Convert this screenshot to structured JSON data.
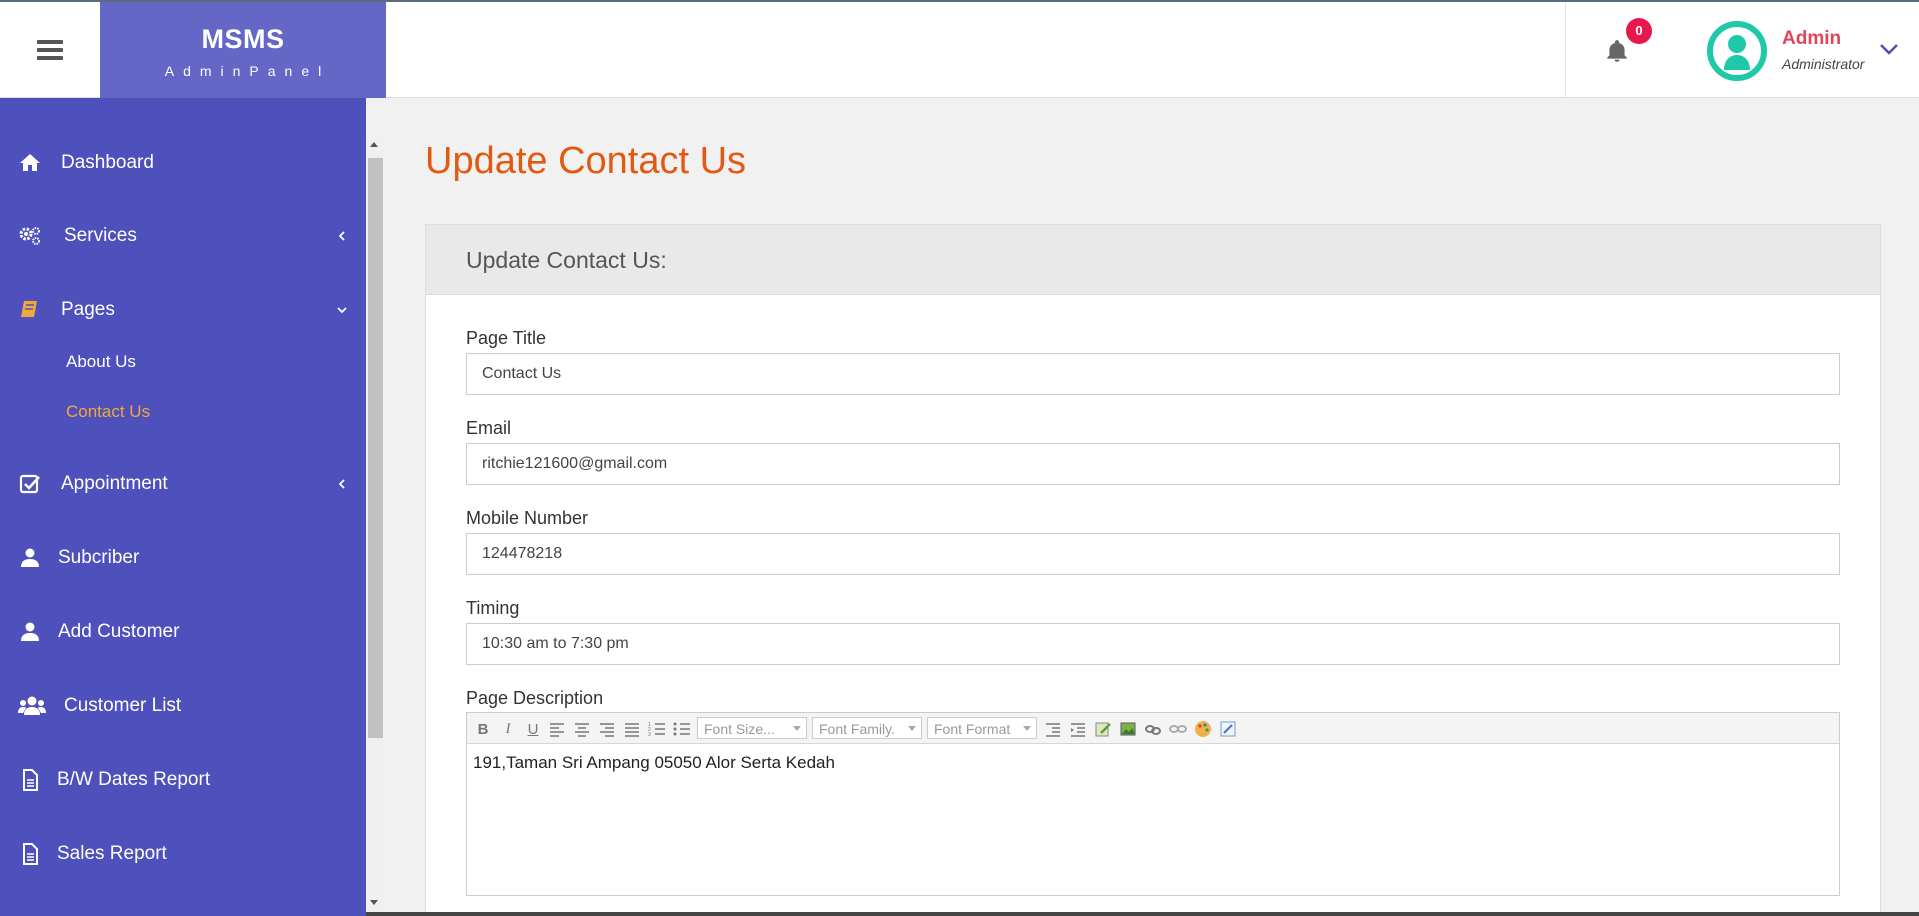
{
  "brand": {
    "name": "MSMS",
    "subtitle": "AdminPanel"
  },
  "notifications": {
    "count": "0"
  },
  "user": {
    "name": "Admin",
    "role": "Administrator"
  },
  "sidebar": {
    "items": [
      {
        "label": "Dashboard",
        "icon": "home-icon"
      },
      {
        "label": "Services",
        "icon": "gears-icon"
      },
      {
        "label": "Pages",
        "icon": "book-icon"
      },
      {
        "label": "Appointment",
        "icon": "check-square-icon"
      },
      {
        "label": "Subcriber",
        "icon": "user-icon"
      },
      {
        "label": "Add Customer",
        "icon": "user-icon"
      },
      {
        "label": "Customer List",
        "icon": "users-icon"
      },
      {
        "label": "B/W Dates Report",
        "icon": "file-icon"
      },
      {
        "label": "Sales Report",
        "icon": "file-icon"
      }
    ],
    "pages_sub": [
      {
        "label": "About Us"
      },
      {
        "label": "Contact Us"
      }
    ]
  },
  "main": {
    "title": "Update Contact Us",
    "card_title": "Update Contact Us:",
    "fields": {
      "page_title": {
        "label": "Page Title",
        "value": "Contact Us"
      },
      "email": {
        "label": "Email",
        "value": "ritchie121600@gmail.com"
      },
      "mobile": {
        "label": "Mobile Number",
        "value": "124478218"
      },
      "timing": {
        "label": "Timing",
        "value": "10:30 am to 7:30 pm"
      },
      "description": {
        "label": "Page Description",
        "value": "191,Taman Sri Ampang 05050 Alor Serta Kedah"
      }
    },
    "editor_toolbar": {
      "font_size": "Font Size...",
      "font_family": "Font Family.",
      "font_format": "Font Format"
    }
  },
  "colors": {
    "sidebar": "#4e50bb",
    "brand": "#6467c6",
    "accent": "#e25a12",
    "active_sub": "#f3a83b",
    "badge": "#e8184d"
  }
}
